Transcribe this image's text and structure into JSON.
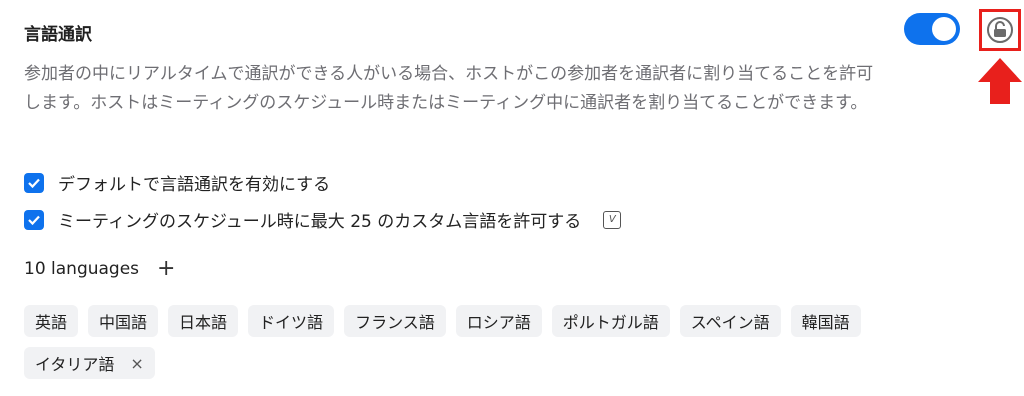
{
  "setting": {
    "title": "言語通訳",
    "description": "参加者の中にリアルタイムで通訳ができる人がいる場合、ホストがこの参加者を通訳者に割り当てることを許可します。ホストはミーティングのスケジュール時またはミーティング中に通訳者を割り当てることができます。",
    "enabled": true,
    "locked": false
  },
  "options": [
    {
      "label": "デフォルトで言語通訳を有効にする",
      "checked": true
    },
    {
      "label": "ミーティングのスケジュール時に最大 25 のカスタム言語を許可する",
      "checked": true,
      "badge": "V"
    }
  ],
  "languages": {
    "count_label": "10 languages",
    "add_label": "+",
    "items": [
      "英語",
      "中国語",
      "日本語",
      "ドイツ語",
      "フランス語",
      "ロシア語",
      "ポルトガル語",
      "スペイン語",
      "韓国語",
      "イタリア語"
    ],
    "remove_label": "×"
  },
  "colors": {
    "accent": "#0e72ed",
    "highlight": "#e8201c",
    "chip_bg": "#f1f2f4"
  },
  "icons": {
    "lock": "unlock-icon",
    "arrow": "red-arrow-up-icon"
  }
}
